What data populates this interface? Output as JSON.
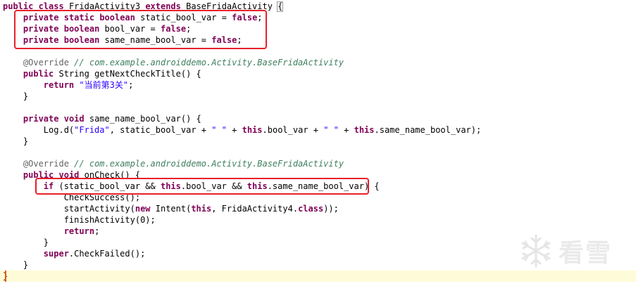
{
  "editor": {
    "lines": [
      {
        "tokens": [
          {
            "t": "public",
            "c": "kw"
          },
          {
            "t": " ",
            "c": "plain"
          },
          {
            "t": "class",
            "c": "kw"
          },
          {
            "t": " FridaActivity3 ",
            "c": "plain"
          },
          {
            "t": "extends",
            "c": "kw"
          },
          {
            "t": " BaseFridaActivity ",
            "c": "plain"
          },
          {
            "t": "{",
            "c": "plain",
            "box": true
          }
        ]
      },
      {
        "tokens": [
          {
            "t": "    ",
            "c": "plain"
          },
          {
            "t": "private",
            "c": "kw"
          },
          {
            "t": " ",
            "c": "plain"
          },
          {
            "t": "static",
            "c": "kw"
          },
          {
            "t": " ",
            "c": "plain"
          },
          {
            "t": "boolean",
            "c": "kw"
          },
          {
            "t": " static_bool_var = ",
            "c": "plain"
          },
          {
            "t": "false",
            "c": "kw"
          },
          {
            "t": ";",
            "c": "plain"
          }
        ]
      },
      {
        "tokens": [
          {
            "t": "    ",
            "c": "plain"
          },
          {
            "t": "private",
            "c": "kw"
          },
          {
            "t": " ",
            "c": "plain"
          },
          {
            "t": "boolean",
            "c": "kw"
          },
          {
            "t": " bool_var = ",
            "c": "plain"
          },
          {
            "t": "false",
            "c": "kw"
          },
          {
            "t": ";",
            "c": "plain"
          }
        ]
      },
      {
        "tokens": [
          {
            "t": "    ",
            "c": "plain"
          },
          {
            "t": "private",
            "c": "kw"
          },
          {
            "t": " ",
            "c": "plain"
          },
          {
            "t": "boolean",
            "c": "kw"
          },
          {
            "t": " same_name_bool_var = ",
            "c": "plain"
          },
          {
            "t": "false",
            "c": "kw"
          },
          {
            "t": ";",
            "c": "plain"
          }
        ]
      },
      {
        "tokens": []
      },
      {
        "tokens": [
          {
            "t": "    ",
            "c": "plain"
          },
          {
            "t": "@Override",
            "c": "ann"
          },
          {
            "t": " ",
            "c": "plain"
          },
          {
            "t": "// com.example.androiddemo.Activity.BaseFridaActivity",
            "c": "cmt"
          }
        ]
      },
      {
        "tokens": [
          {
            "t": "    ",
            "c": "plain"
          },
          {
            "t": "public",
            "c": "kw"
          },
          {
            "t": " String getNextCheckTitle() {",
            "c": "plain"
          }
        ]
      },
      {
        "tokens": [
          {
            "t": "        ",
            "c": "plain"
          },
          {
            "t": "return",
            "c": "kw"
          },
          {
            "t": " ",
            "c": "plain"
          },
          {
            "t": "\"当前第3关\"",
            "c": "str"
          },
          {
            "t": ";",
            "c": "plain"
          }
        ]
      },
      {
        "tokens": [
          {
            "t": "    }",
            "c": "plain"
          }
        ]
      },
      {
        "tokens": []
      },
      {
        "tokens": [
          {
            "t": "    ",
            "c": "plain"
          },
          {
            "t": "private",
            "c": "kw"
          },
          {
            "t": " ",
            "c": "plain"
          },
          {
            "t": "void",
            "c": "kw"
          },
          {
            "t": " same_name_bool_var() {",
            "c": "plain"
          }
        ]
      },
      {
        "tokens": [
          {
            "t": "        Log.d(",
            "c": "plain"
          },
          {
            "t": "\"Frida\"",
            "c": "str"
          },
          {
            "t": ", static_bool_var + ",
            "c": "plain"
          },
          {
            "t": "\" \"",
            "c": "str"
          },
          {
            "t": " + ",
            "c": "plain"
          },
          {
            "t": "this",
            "c": "kw"
          },
          {
            "t": ".bool_var + ",
            "c": "plain"
          },
          {
            "t": "\" \"",
            "c": "str"
          },
          {
            "t": " + ",
            "c": "plain"
          },
          {
            "t": "this",
            "c": "kw"
          },
          {
            "t": ".same_name_bool_var);",
            "c": "plain"
          }
        ]
      },
      {
        "tokens": [
          {
            "t": "    }",
            "c": "plain"
          }
        ]
      },
      {
        "tokens": []
      },
      {
        "tokens": [
          {
            "t": "    ",
            "c": "plain"
          },
          {
            "t": "@Override",
            "c": "ann"
          },
          {
            "t": " ",
            "c": "plain"
          },
          {
            "t": "// com.example.androiddemo.Activity.BaseFridaActivity",
            "c": "cmt"
          }
        ]
      },
      {
        "tokens": [
          {
            "t": "    ",
            "c": "plain"
          },
          {
            "t": "public",
            "c": "kw"
          },
          {
            "t": " ",
            "c": "plain"
          },
          {
            "t": "void",
            "c": "kw"
          },
          {
            "t": " onCheck() {",
            "c": "plain"
          }
        ]
      },
      {
        "tokens": [
          {
            "t": "        ",
            "c": "plain"
          },
          {
            "t": "if",
            "c": "kw"
          },
          {
            "t": " (static_bool_var && ",
            "c": "plain"
          },
          {
            "t": "this",
            "c": "kw"
          },
          {
            "t": ".bool_var && ",
            "c": "plain"
          },
          {
            "t": "this",
            "c": "kw"
          },
          {
            "t": ".same_name_bool_var) {",
            "c": "plain"
          }
        ]
      },
      {
        "tokens": [
          {
            "t": "            CheckSuccess();",
            "c": "plain"
          }
        ]
      },
      {
        "tokens": [
          {
            "t": "            startActivity(",
            "c": "plain"
          },
          {
            "t": "new",
            "c": "kw"
          },
          {
            "t": " Intent(",
            "c": "plain"
          },
          {
            "t": "this",
            "c": "kw"
          },
          {
            "t": ", FridaActivity4.",
            "c": "plain"
          },
          {
            "t": "class",
            "c": "kw"
          },
          {
            "t": "));",
            "c": "plain"
          }
        ]
      },
      {
        "tokens": [
          {
            "t": "            finishActivity(0);",
            "c": "plain"
          }
        ]
      },
      {
        "tokens": [
          {
            "t": "            ",
            "c": "plain"
          },
          {
            "t": "return",
            "c": "kw"
          },
          {
            "t": ";",
            "c": "plain"
          }
        ]
      },
      {
        "tokens": [
          {
            "t": "        }",
            "c": "plain"
          }
        ]
      },
      {
        "tokens": [
          {
            "t": "        ",
            "c": "plain"
          },
          {
            "t": "super",
            "c": "kw"
          },
          {
            "t": ".CheckFailed();",
            "c": "plain"
          }
        ]
      },
      {
        "tokens": [
          {
            "t": "    }",
            "c": "plain"
          }
        ]
      },
      {
        "tokens": [
          {
            "t": "}",
            "c": "plain"
          }
        ],
        "current": true
      }
    ]
  },
  "highlights": [
    {
      "name": "fields-highlight",
      "label": "boolean fields"
    },
    {
      "name": "condition-highlight",
      "label": "if condition"
    }
  ],
  "colors": {
    "keyword": "#7f0055",
    "string": "#2a00ff",
    "annotation": "#646464",
    "comment": "#3f7f5f",
    "highlight_box": "#e8202a",
    "current_line": "#fefbd8"
  },
  "watermark": {
    "text": "看雪",
    "icon": "snowflake-icon"
  }
}
